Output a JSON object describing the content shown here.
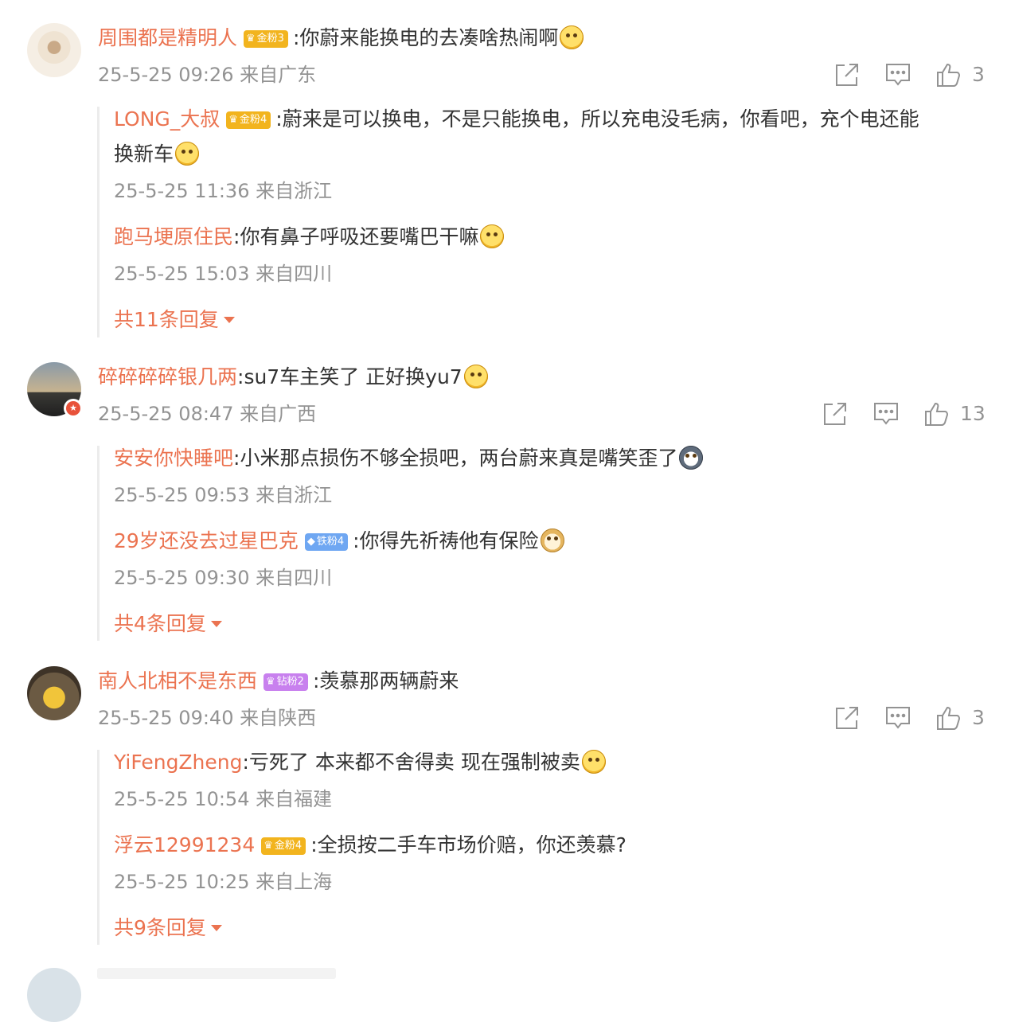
{
  "comments": [
    {
      "user": "周围都是精明人",
      "fan_badge": {
        "label": "金粉3",
        "type": "gold"
      },
      "text": ":你蔚来能换电的去凑啥热闹啊",
      "emoji": "cold-sweat-face",
      "time": "25-5-25 09:26 来自广东",
      "likes": "3",
      "replies": [
        {
          "user": "LONG_大叔",
          "fan_badge": {
            "label": "金粉4",
            "type": "gold"
          },
          "text": ":蔚来是可以换电，不是只能换电，所以充电没毛病，你看吧，充个电还能",
          "text_cont": "换新车",
          "emoji": "crying-laughing-face",
          "time": "25-5-25 11:36 来自浙江"
        },
        {
          "user": "跑马埂原住民",
          "text": ":你有鼻子呼吸还要嘴巴干嘛",
          "emoji": "shush-face",
          "time": "25-5-25 15:03 来自四川"
        }
      ],
      "more": "共11条回复"
    },
    {
      "user": "碎碎碎碎银几两",
      "text": ":su7车主笑了 正好换yu7",
      "emoji": "tears-of-joy-face",
      "time": "25-5-25 08:47 来自广西",
      "likes": "13",
      "replies": [
        {
          "user": "安安你快睡吧",
          "text": ":小米那点损伤不够全损吧，两台蔚来真是嘴笑歪了",
          "emoji": "husky-face",
          "time": "25-5-25 09:53 来自浙江"
        },
        {
          "user": "29岁还没去过星巴克",
          "fan_badge": {
            "label": "铁粉4",
            "type": "iron"
          },
          "text": ":你得先祈祷他有保险",
          "emoji": "doge-face",
          "time": "25-5-25 09:30 来自四川"
        }
      ],
      "more": "共4条回复"
    },
    {
      "user": "南人北相不是东西",
      "fan_badge": {
        "label": "钻粉2",
        "type": "diamond"
      },
      "text": ":羡慕那两辆蔚来",
      "time": "25-5-25 09:40 来自陕西",
      "likes": "3",
      "replies": [
        {
          "user": "YiFengZheng",
          "text": ":亏死了 本来都不舍得卖 现在强制被卖",
          "emoji": "crying-laughing-face",
          "time": "25-5-25 10:54 来自福建"
        },
        {
          "user": "浮云12991234",
          "fan_badge": {
            "label": "金粉4",
            "type": "gold"
          },
          "text": ":全损按二手车市场价赔，你还羡慕?",
          "time": "25-5-25 10:25 来自上海"
        }
      ],
      "more": "共9条回复"
    }
  ],
  "icons": {
    "share": "share-icon",
    "comment": "comment-icon",
    "like": "like-icon"
  },
  "colors": {
    "username": "#eb7350",
    "meta": "#939393",
    "text": "#333333",
    "gold_badge": "#f2b41e",
    "iron_badge": "#6fa7f2",
    "diamond_badge": "#c880ee"
  }
}
